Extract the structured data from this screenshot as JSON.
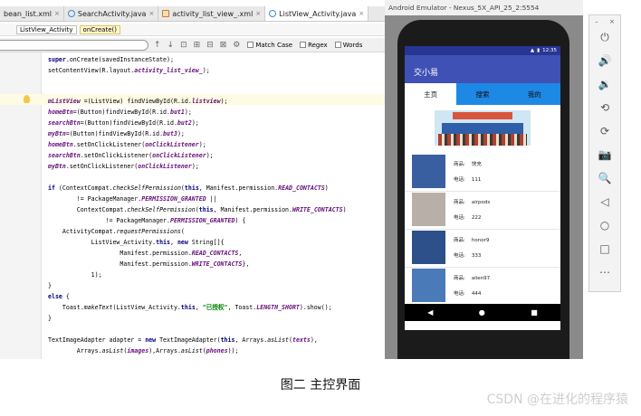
{
  "editor": {
    "tabs": [
      {
        "label": "bean_list.xml",
        "type": "xml"
      },
      {
        "label": "SearchActivity.java",
        "type": "java"
      },
      {
        "label": "activity_list_view_.xml",
        "type": "xml"
      },
      {
        "label": "ListView_Activity.java",
        "type": "java"
      }
    ],
    "close_glyph": "×",
    "breadcrumb": [
      "ListView_Activity",
      "onCreate()"
    ],
    "find": {
      "match_case": "Match Case",
      "regex": "Regex",
      "words": "Words"
    }
  },
  "emulator": {
    "title": "Android Emulator - Nexus_5X_API_25_2:5554",
    "status_time": "12:35",
    "app_title": "交小易",
    "tabs": [
      "主页",
      "搜索",
      "我的"
    ],
    "products": [
      {
        "name_label": "商品:",
        "name": "快充",
        "price_label": "电话:",
        "price": "111",
        "color": "#3a5fa0"
      },
      {
        "name_label": "商品:",
        "name": "airpods",
        "price_label": "电话:",
        "price": "222",
        "color": "#b8b0a8"
      },
      {
        "name_label": "商品:",
        "name": "honor9",
        "price_label": "电话:",
        "price": "333",
        "color": "#2d4f8a"
      },
      {
        "name_label": "商品:",
        "name": "alien97",
        "price_label": "电话:",
        "price": "444",
        "color": "#4a7ab8"
      }
    ],
    "nav": {
      "back": "◀",
      "home": "●",
      "recent": "■"
    },
    "side_controls": {
      "minimize": "–",
      "close": "×",
      "power": "⏻",
      "volume_up": "🔊",
      "volume_down": "🔉",
      "rotate_left": "⟲",
      "rotate_right": "⟳",
      "screenshot": "📷",
      "zoom": "🔍",
      "back": "◁",
      "home": "○",
      "overview": "□",
      "more": "⋯"
    }
  },
  "caption": "图二 主控界面",
  "watermark": "CSDN @在进化的程序猿"
}
